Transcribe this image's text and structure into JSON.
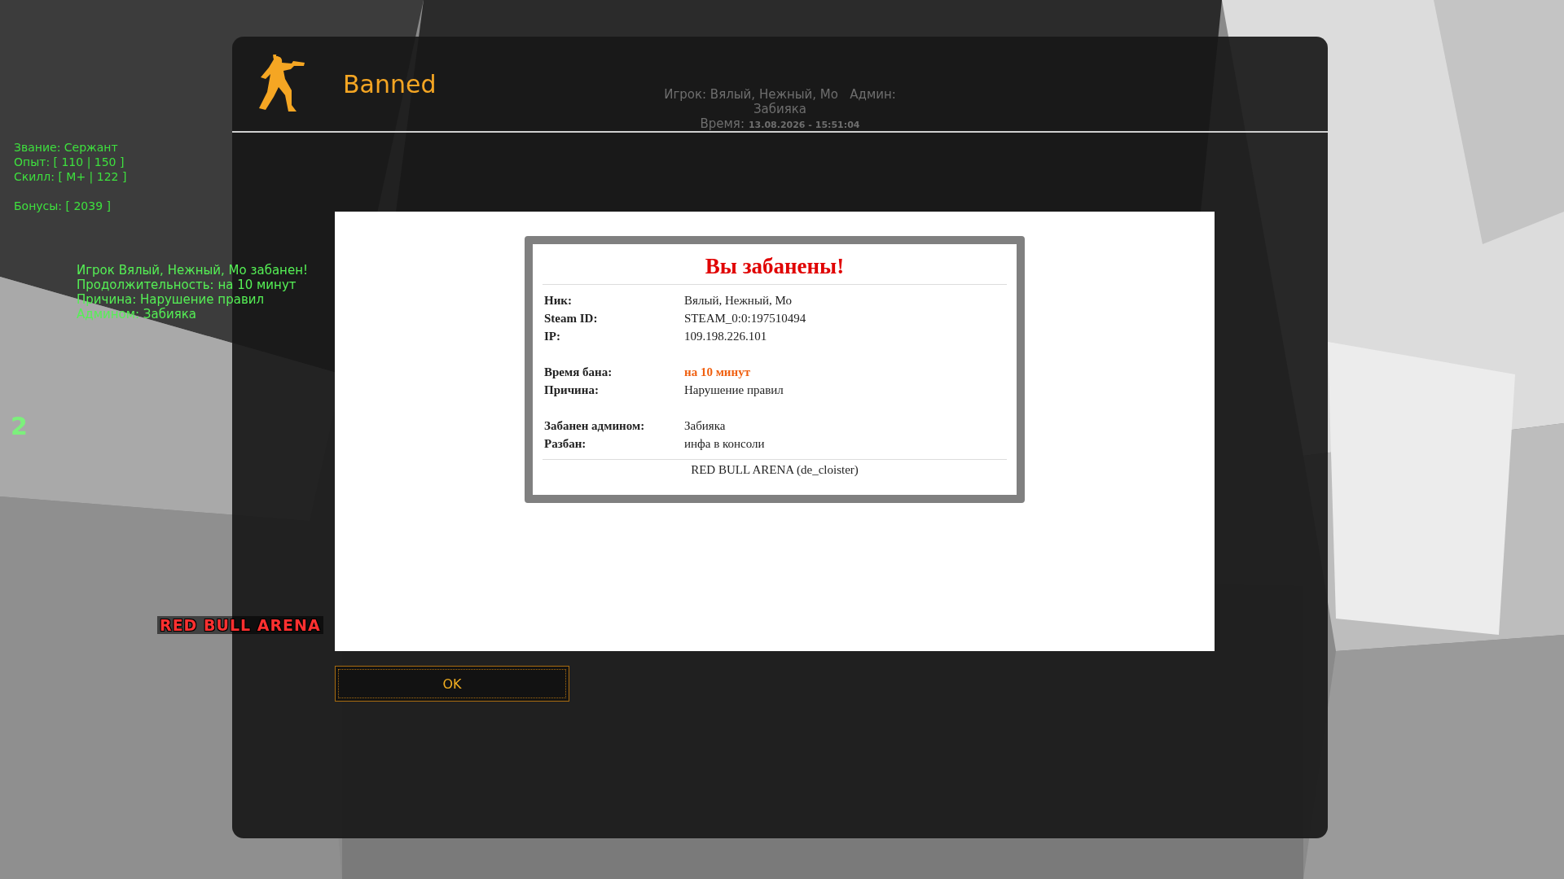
{
  "hud": {
    "stats": [
      "Звание: Сержант",
      "Опыт: [ 110 | 150 ]",
      "Скилл: [ M+ | 122 ]"
    ],
    "bonus": "Бонусы: [ 2039 ]",
    "chat": [
      "Игрок Вялый, Нежный, Мо забанен!",
      "Продолжительность: на 10 минут",
      "Причина: Нарушение правил",
      "Админом: Забияка"
    ],
    "ammo": "2",
    "server_logo": "RED BULL ARENA"
  },
  "dialog": {
    "title": "Banned",
    "info": {
      "player": "Игрок: Вялый, Нежный, Мо   Админ:",
      "admin": "Забияка",
      "time_label": "Время:",
      "time": "13.08.2026 - 15:51:04"
    },
    "card": {
      "heading": "Вы забанены!",
      "groups": [
        [
          {
            "label": "Ник:",
            "value": "Вялый, Нежный, Мо",
            "kind": "plain"
          },
          {
            "label": "Steam ID:",
            "value": "STEAM_0:0:197510494",
            "kind": "plain"
          },
          {
            "label": "IP:",
            "value": "109.198.226.101",
            "kind": "plain"
          }
        ],
        [
          {
            "label": "Время бана:",
            "value": "на 10 минут",
            "kind": "highlight"
          },
          {
            "label": "Причина:",
            "value": "Нарушение правил",
            "kind": "plain"
          }
        ],
        [
          {
            "label": "Забанен админом:",
            "value": "Забияка",
            "kind": "plain"
          },
          {
            "label": "Разбан:",
            "value": "инфа в консоли",
            "kind": "plain"
          }
        ]
      ],
      "footer": "RED BULL ARENA (de_cloister)"
    },
    "button": "OK"
  }
}
